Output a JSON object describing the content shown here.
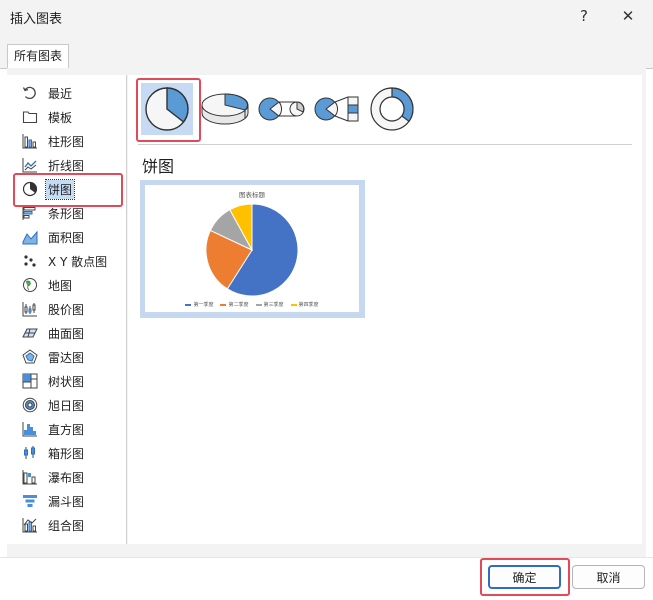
{
  "window": {
    "title": "插入图表",
    "help": "?",
    "close": "✕"
  },
  "tab": {
    "label": "所有图表"
  },
  "categories": [
    {
      "label": "最近",
      "icon": "recent-icon"
    },
    {
      "label": "模板",
      "icon": "template-icon"
    },
    {
      "label": "柱形图",
      "icon": "column-chart-icon"
    },
    {
      "label": "折线图",
      "icon": "line-chart-icon"
    },
    {
      "label": "饼图",
      "icon": "pie-chart-icon",
      "selected": true
    },
    {
      "label": "条形图",
      "icon": "bar-chart-icon"
    },
    {
      "label": "面积图",
      "icon": "area-chart-icon"
    },
    {
      "label": "X Y 散点图",
      "icon": "scatter-chart-icon"
    },
    {
      "label": "地图",
      "icon": "map-chart-icon"
    },
    {
      "label": "股价图",
      "icon": "stock-chart-icon"
    },
    {
      "label": "曲面图",
      "icon": "surface-chart-icon"
    },
    {
      "label": "雷达图",
      "icon": "radar-chart-icon"
    },
    {
      "label": "树状图",
      "icon": "treemap-chart-icon"
    },
    {
      "label": "旭日图",
      "icon": "sunburst-chart-icon"
    },
    {
      "label": "直方图",
      "icon": "histogram-chart-icon"
    },
    {
      "label": "箱形图",
      "icon": "box-whisker-chart-icon"
    },
    {
      "label": "瀑布图",
      "icon": "waterfall-chart-icon"
    },
    {
      "label": "漏斗图",
      "icon": "funnel-chart-icon"
    },
    {
      "label": "组合图",
      "icon": "combo-chart-icon"
    }
  ],
  "subtypes": [
    {
      "icon": "pie-icon",
      "selected": true
    },
    {
      "icon": "3d-pie-icon"
    },
    {
      "icon": "pie-of-pie-icon"
    },
    {
      "icon": "bar-of-pie-icon"
    },
    {
      "icon": "doughnut-icon"
    }
  ],
  "section": {
    "title": "饼图"
  },
  "chart_data": {
    "type": "pie",
    "title": "图表标题",
    "categories": [
      "第一季度",
      "第二季度",
      "第三季度",
      "第四季度"
    ],
    "values": [
      59,
      23,
      10,
      8
    ],
    "colors": [
      "#4472c4",
      "#ed7d31",
      "#a5a5a5",
      "#ffc000"
    ],
    "legend": "bottom"
  },
  "buttons": {
    "ok": "确定",
    "cancel": "取消"
  }
}
